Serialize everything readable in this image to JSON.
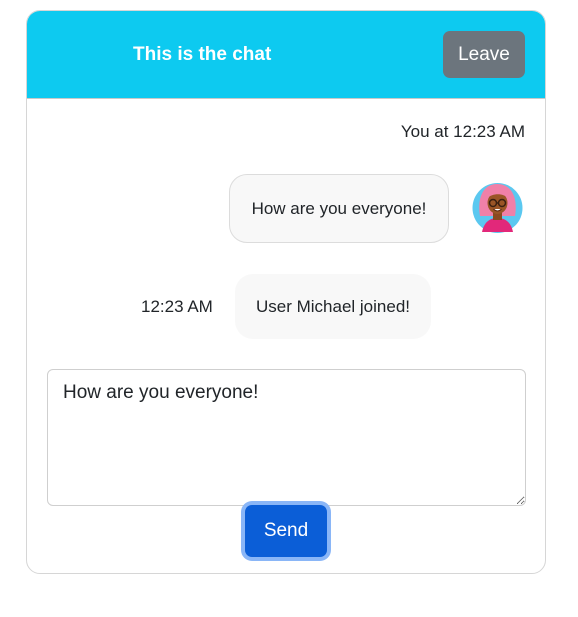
{
  "header": {
    "title": "This is the chat",
    "leave_label": "Leave"
  },
  "messages": [
    {
      "sender_meta": "You at 12:23 AM",
      "text": "How are you everyone!",
      "avatar_icon": "user-avatar-icon"
    },
    {
      "time": "12:23 AM",
      "text": "User Michael joined!"
    }
  ],
  "composer": {
    "value": "How are you everyone!",
    "send_label": "Send"
  },
  "colors": {
    "header_bg": "#0dcaf0",
    "leave_bg": "#6c757d",
    "send_bg": "#0b5ed7"
  }
}
